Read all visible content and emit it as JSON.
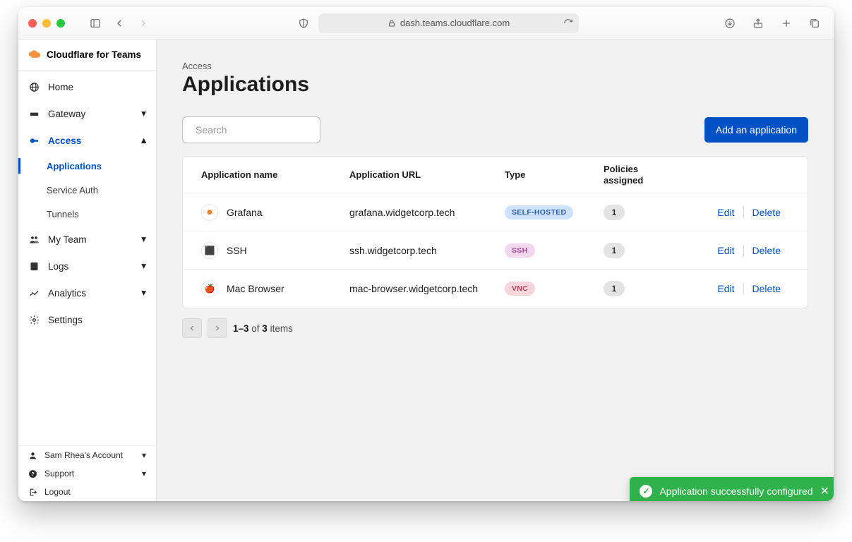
{
  "browser": {
    "url": "dash.teams.cloudflare.com"
  },
  "sidebar": {
    "brand": "Cloudflare for Teams",
    "items": [
      {
        "label": "Home"
      },
      {
        "label": "Gateway"
      },
      {
        "label": "Access"
      },
      {
        "label": "My Team"
      },
      {
        "label": "Logs"
      },
      {
        "label": "Analytics"
      },
      {
        "label": "Settings"
      }
    ],
    "access_sub": [
      {
        "label": "Applications"
      },
      {
        "label": "Service Auth"
      },
      {
        "label": "Tunnels"
      }
    ],
    "footer": {
      "account": "Sam Rhea's Account",
      "support": "Support",
      "logout": "Logout"
    }
  },
  "page": {
    "breadcrumb": "Access",
    "title": "Applications",
    "search_placeholder": "Search",
    "add_button": "Add an application"
  },
  "table": {
    "headers": {
      "name": "Application name",
      "url": "Application URL",
      "type": "Type",
      "policies_l1": "Policies",
      "policies_l2": "assigned"
    },
    "rows": [
      {
        "name": "Grafana",
        "url": "grafana.widgetcorp.tech",
        "type": "SELF-HOSTED",
        "type_class": "self",
        "policies": "1",
        "icon_color": "#f38020",
        "icon_glyph": "✹"
      },
      {
        "name": "SSH",
        "url": "ssh.widgetcorp.tech",
        "type": "SSH",
        "type_class": "ssh",
        "policies": "1",
        "icon_color": "#1d1d1d",
        "icon_glyph": "⬛"
      },
      {
        "name": "Mac Browser",
        "url": "mac-browser.widgetcorp.tech",
        "type": "VNC",
        "type_class": "vnc",
        "policies": "1",
        "icon_color": "#777",
        "icon_glyph": "🍎"
      }
    ],
    "actions": {
      "edit": "Edit",
      "delete": "Delete"
    }
  },
  "pagination": {
    "range": "1–3",
    "of": " of ",
    "total": "3",
    "items": " items"
  },
  "toast": {
    "message": "Application successfully configured"
  }
}
